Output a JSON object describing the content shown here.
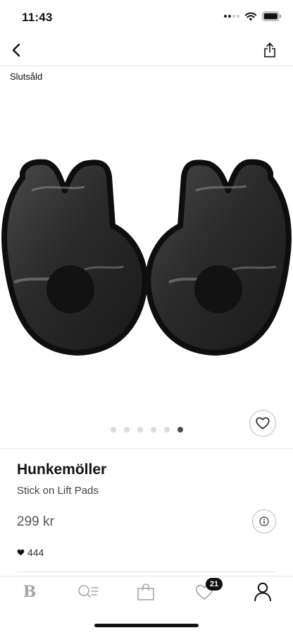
{
  "status_bar": {
    "time": "11:43"
  },
  "product": {
    "status_label": "Slutsåld",
    "brand": "Hunkemöller",
    "name": "Stick on Lift Pads",
    "price": "299 kr",
    "likes": "444",
    "image_count": 6,
    "active_image": 6
  },
  "icons": {
    "back": "chevron-left-icon",
    "share": "share-icon",
    "favorite": "heart-outline-icon",
    "info": "info-icon",
    "likes": "heart-filled-icon"
  },
  "tab_bar": {
    "home_logo": "B",
    "wishlist_badge": "21"
  },
  "colors": {
    "text": "#111111",
    "muted": "#555555",
    "tab_icon": "#a6a6a6",
    "badge_bg": "#111111"
  }
}
